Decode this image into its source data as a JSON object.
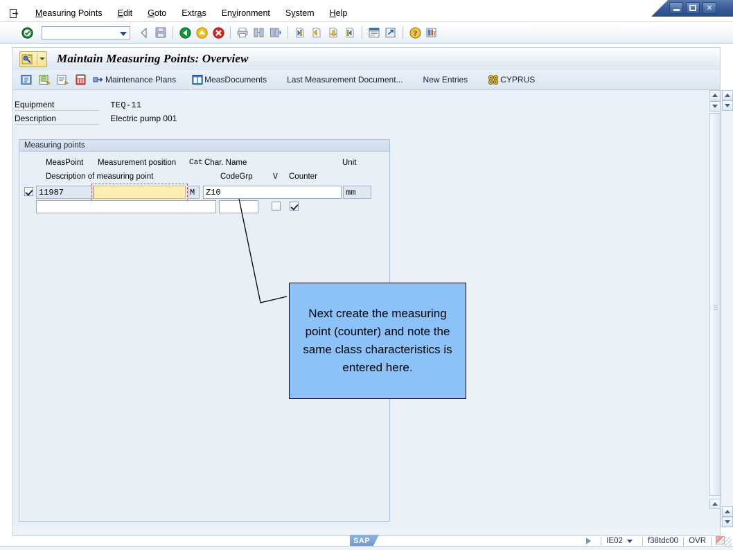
{
  "window": {
    "controls": [
      {
        "name": "minimize",
        "glyph": "_"
      },
      {
        "name": "maximize",
        "glyph": "❐"
      },
      {
        "name": "close",
        "glyph": "✕"
      }
    ]
  },
  "menubar": {
    "system_icon": "session-icon",
    "items": [
      {
        "label": "Measuring Points",
        "accel": "M"
      },
      {
        "label": "Edit",
        "accel": "E"
      },
      {
        "label": "Goto",
        "accel": "G"
      },
      {
        "label": "Extras",
        "accel": "a"
      },
      {
        "label": "Environment",
        "accel": "v"
      },
      {
        "label": "System",
        "accel": "y"
      },
      {
        "label": "Help",
        "accel": "H"
      }
    ]
  },
  "standard_toolbar": {
    "enter_icon": "enter-check-icon",
    "command_field": {
      "value": "",
      "placeholder": ""
    },
    "icons": [
      "back-arrow-icon",
      "save-icon",
      "back-green-icon",
      "exit-yellow-icon",
      "cancel-red-icon",
      "print-icon",
      "find-icon",
      "find-next-icon",
      "first-page-icon",
      "previous-page-icon",
      "next-page-icon",
      "last-page-icon",
      "create-session-icon",
      "create-shortcut-icon",
      "help-icon",
      "customize-layout-icon"
    ]
  },
  "screen": {
    "icon": "maintain-measuring-points-icon",
    "title": "Maintain Measuring Points: Overview"
  },
  "app_toolbar": {
    "buttons": [
      {
        "label": "",
        "icon": "choose-detail-icon"
      },
      {
        "label": "",
        "icon": "measurement-reading-icon"
      },
      {
        "label": "",
        "icon": "document-list-icon"
      },
      {
        "label": "",
        "icon": "calculator-icon"
      },
      {
        "label": "Maintenance Plans",
        "icon": "maintenance-plans-icon"
      },
      {
        "label": "MeasDocuments",
        "icon": "meas-documents-icon"
      },
      {
        "label": "Last Measurement Document...",
        "icon": ""
      },
      {
        "label": "New Entries",
        "icon": ""
      },
      {
        "label": "CYPRUS",
        "icon": "cyprus-icon"
      }
    ]
  },
  "header_fields": [
    {
      "label": "Equipment",
      "value": "TEQ-11",
      "mono": true
    },
    {
      "label": "Description",
      "value": "Electric pump 001",
      "mono": false
    }
  ],
  "measuring_points": {
    "group_title": "Measuring points",
    "column_headers_row1": [
      "MeasPoint",
      "Measurement position",
      "Cat",
      "Char. Name",
      "Unit"
    ],
    "column_headers_row2": [
      "Description of measuring point",
      "CodeGrp",
      "V",
      "Counter"
    ],
    "rows": [
      {
        "selected": true,
        "meas_point": "11987",
        "measurement_position": "",
        "measurement_position_focused": true,
        "cat": "M",
        "char_name": "Z10",
        "unit": "mm",
        "description": "",
        "code_grp": "",
        "v_checked": false,
        "counter_checked": true
      }
    ]
  },
  "callout": {
    "text": "Next create the measuring point (counter) and note the same class characteristics is entered here.",
    "fill_color": "#8cc2f7",
    "border_color": "#000000"
  },
  "status_bar": {
    "sap_logo": "SAP",
    "play_icon": "play-triangle-icon",
    "transaction": "IE02",
    "server": "f38tdc00",
    "insert_mode": "OVR",
    "flag_icon": "status-flag-icon"
  }
}
